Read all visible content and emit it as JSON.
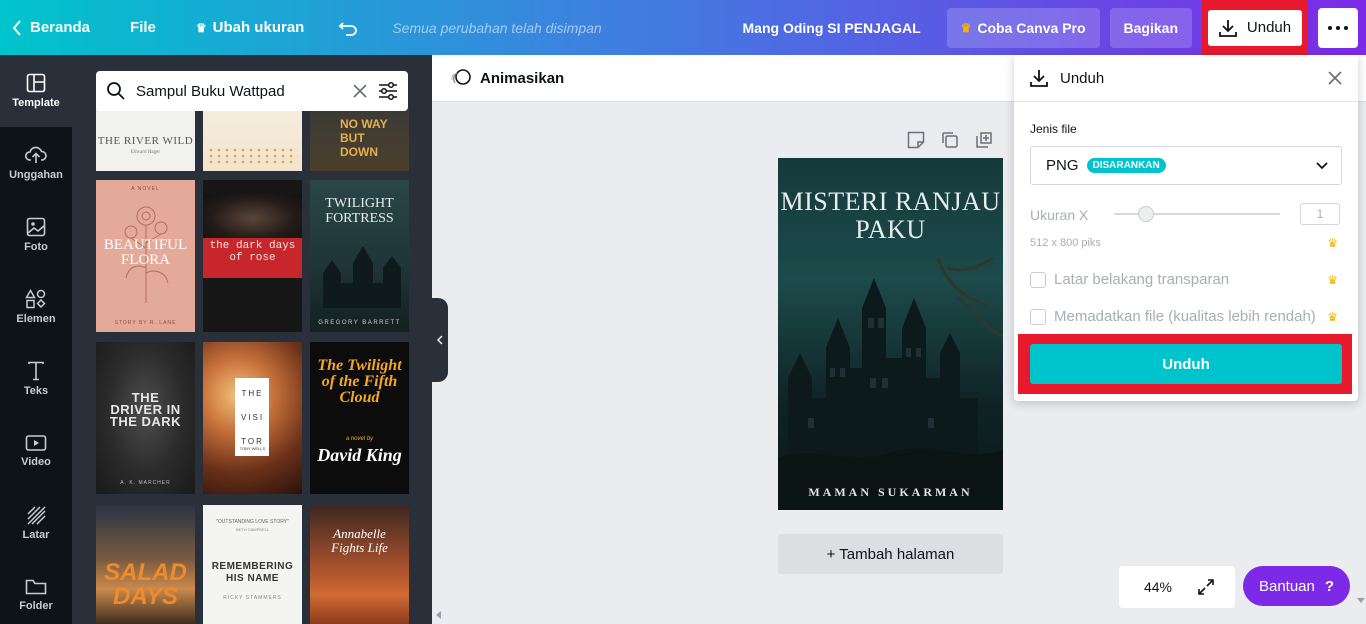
{
  "topbar": {
    "home_label": "Beranda",
    "file_label": "File",
    "resize_label": "Ubah ukuran",
    "save_status": "Semua perubahan telah disimpan",
    "user_name": "Mang Oding SI PENJAGAL",
    "pro_label": "Coba Canva Pro",
    "share_label": "Bagikan",
    "download_label": "Unduh"
  },
  "sidebar": {
    "items": [
      {
        "label": "Template",
        "icon": "template-icon"
      },
      {
        "label": "Unggahan",
        "icon": "upload-icon"
      },
      {
        "label": "Foto",
        "icon": "photo-icon"
      },
      {
        "label": "Elemen",
        "icon": "elements-icon"
      },
      {
        "label": "Teks",
        "icon": "text-icon"
      },
      {
        "label": "Video",
        "icon": "video-icon"
      },
      {
        "label": "Latar",
        "icon": "background-icon"
      },
      {
        "label": "Folder",
        "icon": "folder-icon"
      }
    ]
  },
  "panel": {
    "search_value": "Sampul Buku Wattpad",
    "covers": {
      "c1": {
        "title": "THE RIVER WILD",
        "sub": "Edward Hager"
      },
      "c2": {
        "title": ""
      },
      "c3": {
        "title": "NO WAY BUT DOWN"
      },
      "c4": {
        "title": "BEAUTIFUL FLORA",
        "top": "A NOVEL",
        "bottom": "STORY BY R. LANE"
      },
      "c5": {
        "title": "the dark days of rose"
      },
      "c6": {
        "title": "TWILIGHT FORTRESS",
        "bottom": "GREGORY BARRETT"
      },
      "c7": {
        "title": "THE DRIVER IN THE DARK",
        "bottom": "A. K. MARCHER"
      },
      "c8": {
        "title": "THE VISI TOR",
        "bottom": "TOBY WELLS"
      },
      "c9": {
        "title": "The Twilight of the Fifth Cloud",
        "mid": "a novel by",
        "author": "David King"
      },
      "c10": {
        "title": "SALAD DAYS"
      },
      "c11": {
        "top": "\"OUTSTANDING LOVE STORY\"",
        "author": "BETH CAMPBELL",
        "title": "REMEMBERING HIS NAME",
        "bottom": "RICKY STAMMERS"
      },
      "c12": {
        "title": "Annabelle Fights Life"
      }
    }
  },
  "editor": {
    "animate_label": "Animasikan",
    "book_title": "MISTERI RANJAU PAKU",
    "book_author": "MAMAN SUKARMAN",
    "add_page_label": "+ Tambah halaman",
    "zoom_value": "44%",
    "help_label": "Bantuan",
    "help_q": "?"
  },
  "download_panel": {
    "title": "Unduh",
    "file_type_label": "Jenis file",
    "file_type_value": "PNG",
    "file_type_badge": "DISARANKAN",
    "size_label": "Ukuran X",
    "size_value": "1",
    "dimensions": "512 x 800 piks",
    "transparent_label": "Latar belakang transparan",
    "compress_label": "Memadatkan file (kualitas lebih rendah)",
    "button_label": "Unduh"
  },
  "colors": {
    "brand_teal": "#00c4cc",
    "brand_purple": "#7d2ae8",
    "highlight_red": "#e8192c",
    "crown_gold": "#f4b400"
  }
}
